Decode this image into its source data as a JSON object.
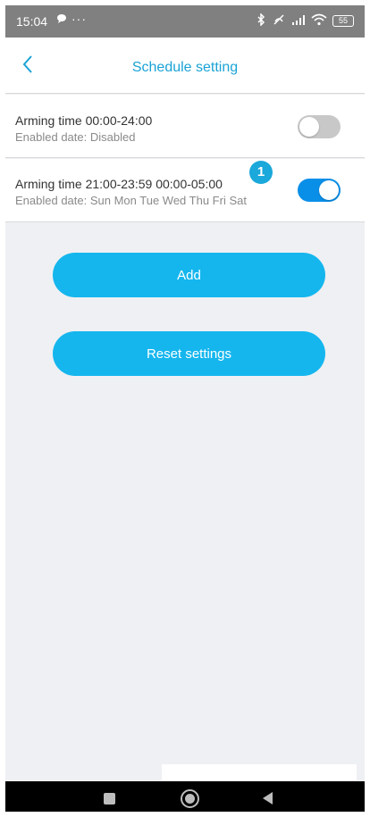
{
  "status_bar": {
    "time": "15:04",
    "message_icon": "speech-bubble-icon",
    "more": "···",
    "right_icons": [
      "bluetooth-icon",
      "silent-icon",
      "signal-icon",
      "wifi-icon"
    ],
    "battery": "55"
  },
  "header": {
    "title": "Schedule setting",
    "back_icon": "chevron-left-icon"
  },
  "schedules": [
    {
      "arming_time": "Arming time 00:00-24:00",
      "enabled_date": "Enabled date: Disabled",
      "enabled": false
    },
    {
      "arming_time": "Arming time 21:00-23:59 00:00-05:00",
      "enabled_date": "Enabled date: Sun Mon Tue Wed Thu Fri Sat",
      "enabled": true,
      "badge": "1"
    }
  ],
  "buttons": {
    "add": "Add",
    "reset": "Reset settings"
  },
  "nav_bar": [
    "recents-icon",
    "home-icon",
    "back-icon"
  ],
  "colors": {
    "accent": "#15b6ee",
    "title": "#1aa3d6",
    "toggle_on": "#0a8fe8",
    "toggle_off": "#c8c8c8",
    "background": "#eff0f3"
  }
}
